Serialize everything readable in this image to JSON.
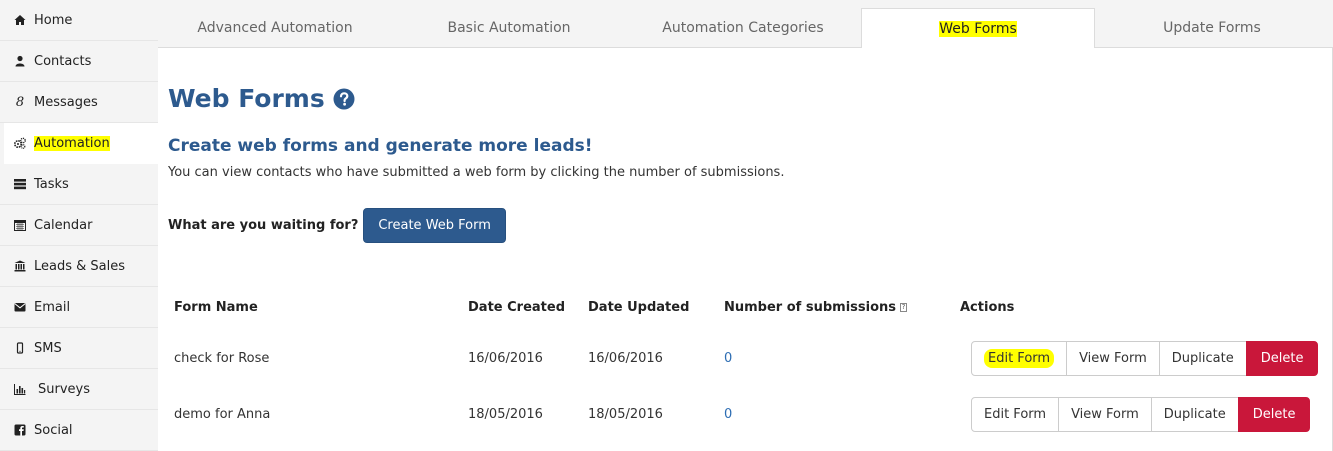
{
  "sidebar": {
    "items": [
      {
        "label": "Home",
        "icon": "home-icon",
        "highlight": false
      },
      {
        "label": "Contacts",
        "icon": "user-icon",
        "highlight": false
      },
      {
        "label": "Messages",
        "icon": "messages-icon",
        "highlight": false
      },
      {
        "label": "Automation",
        "icon": "cogs-icon",
        "highlight": true,
        "active": true
      },
      {
        "label": "Tasks",
        "icon": "tasks-icon",
        "highlight": false
      },
      {
        "label": "Calendar",
        "icon": "calendar-icon",
        "highlight": false
      },
      {
        "label": "Leads & Sales",
        "icon": "bank-icon",
        "highlight": false
      },
      {
        "label": "Email",
        "icon": "envelope-icon",
        "highlight": false
      },
      {
        "label": "SMS",
        "icon": "mobile-icon",
        "highlight": false
      },
      {
        "label": "Surveys",
        "icon": "bar-chart-icon",
        "highlight": false
      },
      {
        "label": "Social",
        "icon": "facebook-icon",
        "highlight": false
      }
    ]
  },
  "tabs": [
    {
      "label": "Advanced Automation"
    },
    {
      "label": "Basic Automation"
    },
    {
      "label": "Automation Categories"
    },
    {
      "label": "Web Forms",
      "active": true,
      "highlight": true
    },
    {
      "label": "Update Forms"
    }
  ],
  "main": {
    "title": "Web Forms",
    "subtitle": "Create web forms and generate more leads!",
    "description": "You can view contacts who have submitted a web form by clicking the number of submissions.",
    "cta_label": "What are you waiting for?",
    "cta_button": "Create Web Form"
  },
  "table": {
    "headers": [
      "Form Name",
      "Date Created",
      "Date Updated",
      "Number of submissions",
      "Actions"
    ],
    "rows": [
      {
        "name": "check for Rose",
        "created": "16/06/2016",
        "updated": "16/06/2016",
        "submissions": "0"
      },
      {
        "name": "demo for Anna",
        "created": "18/05/2016",
        "updated": "18/05/2016",
        "submissions": "0"
      }
    ],
    "actions": {
      "edit": "Edit Form",
      "view": "View Form",
      "duplicate": "Duplicate",
      "delete": "Delete"
    }
  },
  "colors": {
    "brand": "#2d5a8e",
    "danger": "#c9173a",
    "highlight": "#ffff00",
    "link": "#2d6db3"
  }
}
